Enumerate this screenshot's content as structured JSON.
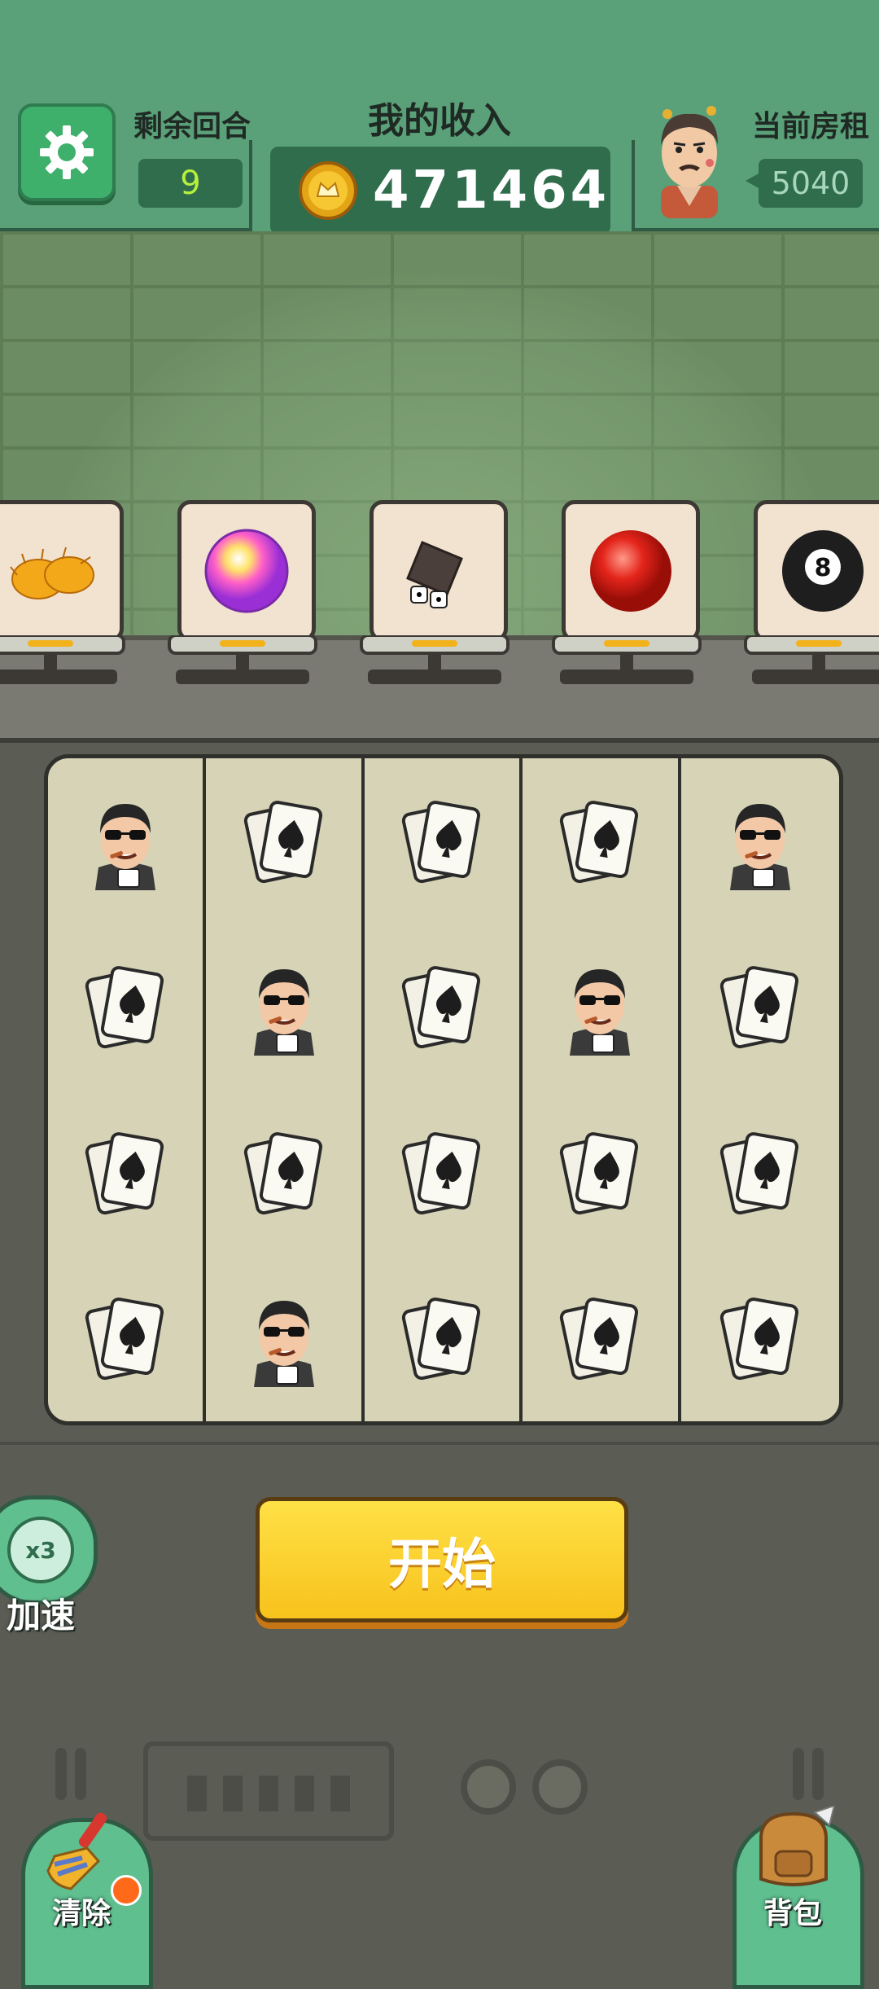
{
  "header": {
    "rounds_label": "剩余回合",
    "rounds_value": "9",
    "income_title": "我的收入",
    "income_value": "471464",
    "rent_label": "当前房租",
    "rent_value": "5040"
  },
  "shelf_items": [
    {
      "name": "golden-fur",
      "icon": "golden-fur-icon"
    },
    {
      "name": "rainbow-orb",
      "icon": "rainbow-orb-icon"
    },
    {
      "name": "dice-cup",
      "icon": "dice-cup-icon"
    },
    {
      "name": "red-ball",
      "icon": "red-ball-icon"
    },
    {
      "name": "billiard-8-ball",
      "icon": "billiard-8-ball-icon",
      "text": "8"
    }
  ],
  "grid": [
    [
      "gambler",
      "cards",
      "cards",
      "cards",
      "gambler"
    ],
    [
      "cards",
      "gambler",
      "cards",
      "gambler",
      "cards"
    ],
    [
      "cards",
      "cards",
      "cards",
      "cards",
      "cards"
    ],
    [
      "cards",
      "gambler",
      "cards",
      "cards",
      "cards"
    ]
  ],
  "controls": {
    "start_label": "开始",
    "speed_badge": "x3",
    "speed_label": "加速",
    "clear_label": "清除",
    "bag_label": "背包"
  },
  "colors": {
    "header_green": "#5aa179",
    "dark_green": "#2f6d4c",
    "rounds_text": "#b7ef3c",
    "start_yellow": "#f7c21c"
  }
}
